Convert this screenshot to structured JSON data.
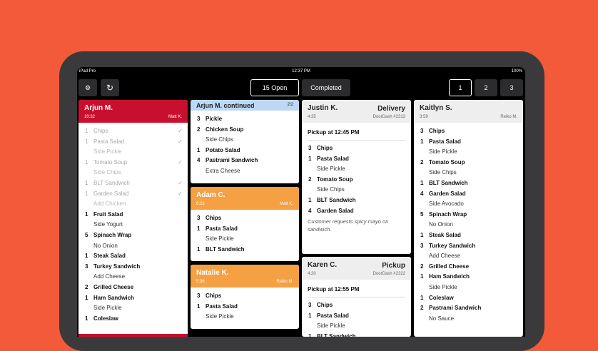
{
  "status": {
    "device": "iPad Pro",
    "time": "12:37 PM",
    "battery": "100%"
  },
  "toolbar": {
    "open_label": "15 Open",
    "completed_label": "Completed",
    "pages": [
      "1",
      "2",
      "3"
    ]
  },
  "tickets": {
    "arjun": {
      "name": "Arjun M.",
      "time": "10:32",
      "server": "Matt K.",
      "lines": [
        {
          "q": "1",
          "t": "Chips",
          "done": true
        },
        {
          "q": "1",
          "t": "Pasta Salad",
          "done": true
        },
        {
          "mod": "Side Pickle",
          "done": true
        },
        {
          "q": "1",
          "t": "Tomato Soup",
          "done": true
        },
        {
          "mod": "Side Chips",
          "done": true
        },
        {
          "q": "1",
          "t": "BLT Sandwich",
          "done": true
        },
        {
          "q": "1",
          "t": "Garden Salad",
          "done": true
        },
        {
          "mod": "Add Chicken",
          "done": true
        },
        {
          "q": "1",
          "t": "Fruit Salad"
        },
        {
          "mod": "Side Yogurt"
        },
        {
          "q": "5",
          "t": "Spinach Wrap"
        },
        {
          "mod": "No Onion"
        },
        {
          "q": "1",
          "t": "Steak Salad"
        },
        {
          "q": "3",
          "t": "Turkey Sandwich"
        },
        {
          "mod": "Add Cheese"
        },
        {
          "q": "2",
          "t": "Grilled Cheese"
        },
        {
          "q": "1",
          "t": "Ham Sandwich"
        },
        {
          "mod": "Side Pickle"
        },
        {
          "q": "1",
          "t": "Coleslaw"
        }
      ]
    },
    "arjun_cont": {
      "name": "Arjun M. continued",
      "page": "2/2",
      "lines": [
        {
          "q": "3",
          "t": "Pickle"
        },
        {
          "q": "2",
          "t": "Chicken Soup"
        },
        {
          "mod": "Side Chips"
        },
        {
          "q": "1",
          "t": "Potato Salad"
        },
        {
          "q": "4",
          "t": "Pastrami Sandwich"
        },
        {
          "mod": "Extra Cheese"
        }
      ]
    },
    "adam": {
      "name": "Adam C.",
      "time": "6:22",
      "server": "Matt K.",
      "lines": [
        {
          "q": "3",
          "t": "Chips"
        },
        {
          "q": "1",
          "t": "Pasta Salad"
        },
        {
          "mod": "Side Pickle"
        },
        {
          "q": "1",
          "t": "BLT Sandwich"
        }
      ]
    },
    "natalie": {
      "name": "Natalie K.",
      "time": "5:36",
      "server": "Reiko M.",
      "lines": [
        {
          "q": "3",
          "t": "Chips"
        },
        {
          "q": "1",
          "t": "Pasta Salad"
        },
        {
          "mod": "Side Pickle"
        }
      ]
    },
    "justin": {
      "name": "Justin K.",
      "type": "Delivery",
      "time": "4:35",
      "source": "DoorDash #2313",
      "pickup": "Pickup at 12:45 PM",
      "lines": [
        {
          "q": "3",
          "t": "Chips"
        },
        {
          "q": "1",
          "t": "Pasta Salad"
        },
        {
          "mod": "Side Pickle"
        },
        {
          "q": "2",
          "t": "Tomato Soup"
        },
        {
          "mod": "Side Chips"
        },
        {
          "q": "1",
          "t": "BLT Sandwich"
        },
        {
          "q": "4",
          "t": "Garden Salad"
        }
      ],
      "note": "Customer requests spicy mayo on sandwich."
    },
    "karen": {
      "name": "Karen C.",
      "type": "Pickup",
      "time": "4:20",
      "source": "DoorDash #2322",
      "pickup": "Pickup at 12:55 PM",
      "lines": [
        {
          "q": "3",
          "t": "Chips"
        },
        {
          "q": "1",
          "t": "Pasta Salad"
        },
        {
          "mod": "Side Pickle"
        },
        {
          "q": "1",
          "t": "BLT Sandwich"
        }
      ]
    },
    "kaitlyn": {
      "name": "Kaitlyn S.",
      "time": "3:59",
      "server": "Reiko M.",
      "lines": [
        {
          "q": "3",
          "t": "Chips"
        },
        {
          "q": "1",
          "t": "Pasta Salad"
        },
        {
          "mod": "Side Pickle"
        },
        {
          "q": "2",
          "t": "Tomato Soup"
        },
        {
          "mod": "Side Chips"
        },
        {
          "q": "1",
          "t": "BLT Sandwich"
        },
        {
          "q": "4",
          "t": "Garden Salad"
        },
        {
          "mod": "Side Avocado"
        },
        {
          "q": "5",
          "t": "Spinach Wrap"
        },
        {
          "mod": "No Onion"
        },
        {
          "q": "1",
          "t": "Steak Salad"
        },
        {
          "q": "3",
          "t": "Turkey Sandwich"
        },
        {
          "mod": "Add Cheese"
        },
        {
          "q": "2",
          "t": "Grilled Cheese"
        },
        {
          "q": "1",
          "t": "Ham Sandwich"
        },
        {
          "mod": "Side Pickle"
        },
        {
          "q": "1",
          "t": "Coleslaw"
        },
        {
          "q": "2",
          "t": "Pastrami Sandwich"
        },
        {
          "mod": "No Sauce"
        }
      ]
    }
  },
  "colors": {
    "background": "#f25a3a",
    "ticket_red": "#c8102e",
    "ticket_orange": "#f5a042",
    "ticket_continued": "#bcd8f5"
  }
}
